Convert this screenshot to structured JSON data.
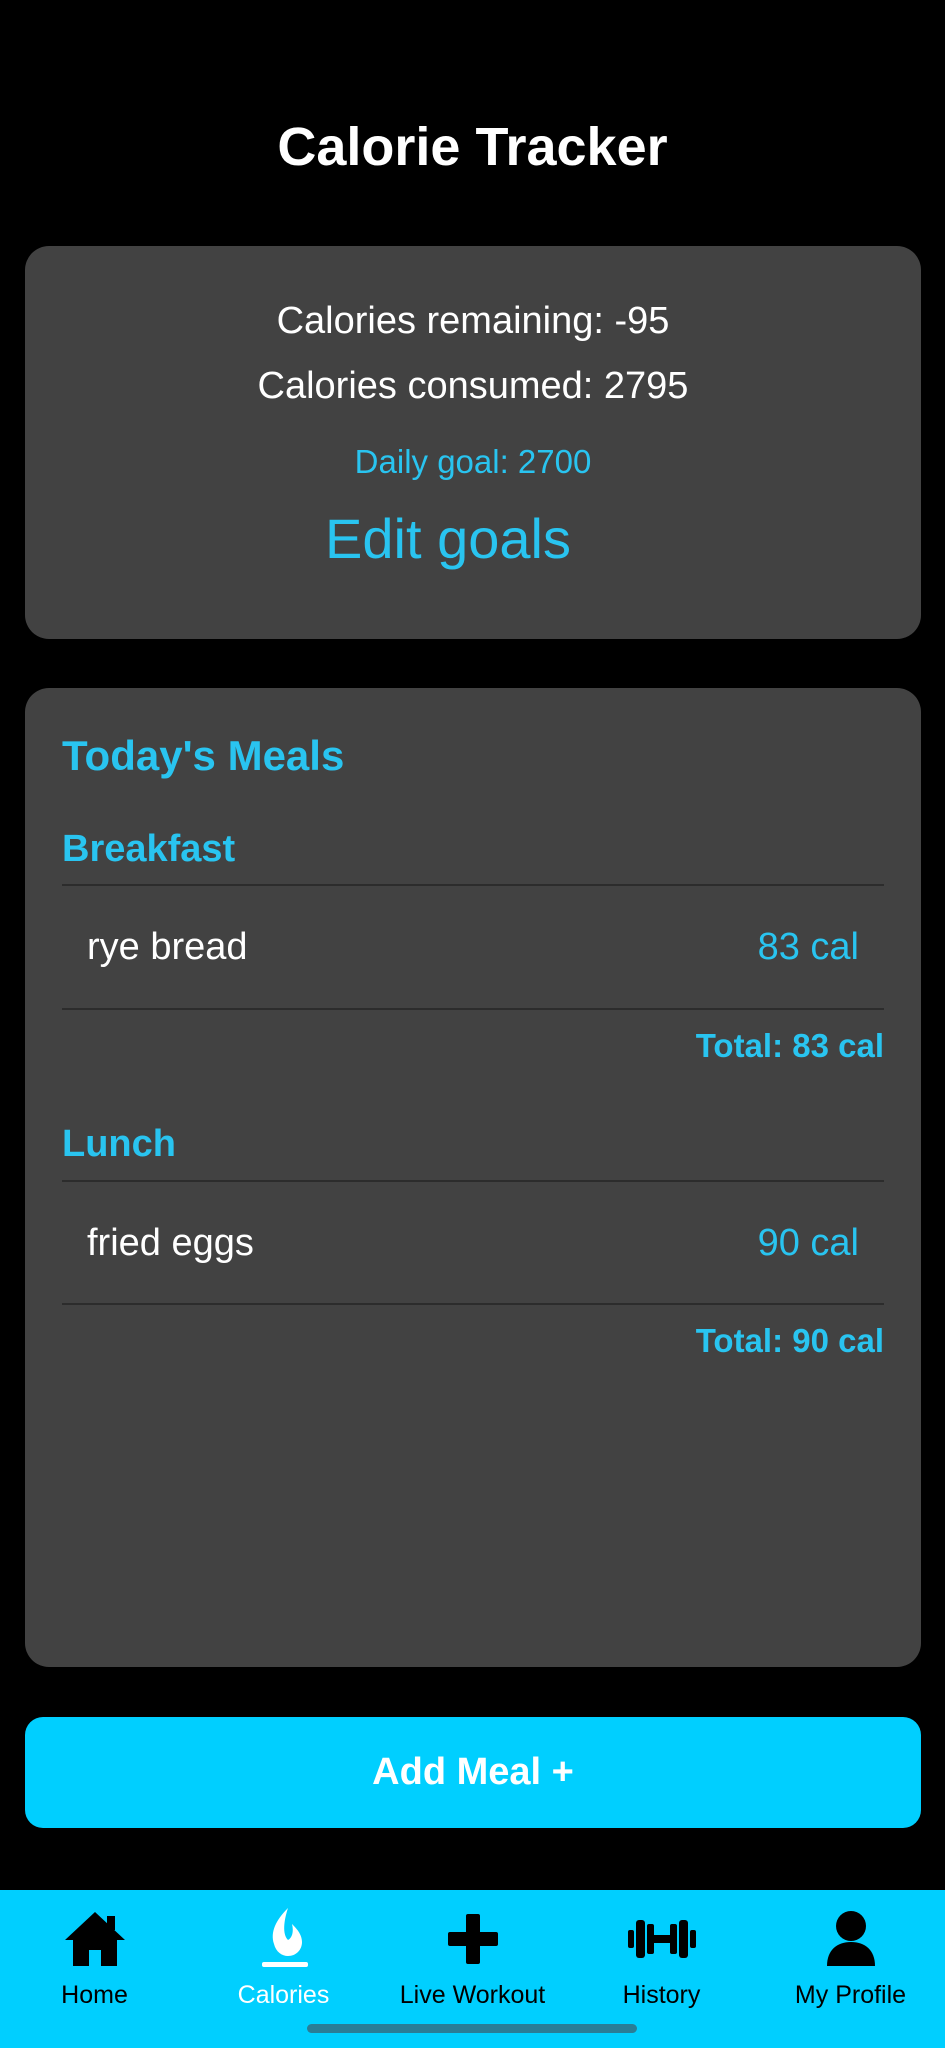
{
  "header": {
    "title": "Calorie Tracker"
  },
  "summary": {
    "remaining_text": "Calories remaining: -95",
    "consumed_text": "Calories consumed: 2795",
    "goal_text": "Daily goal: 2700",
    "edit_goals_label": "Edit goals"
  },
  "meals": {
    "title": "Today's Meals",
    "sections": [
      {
        "name": "Breakfast",
        "items": [
          {
            "name": "rye bread",
            "calories": "83 cal"
          }
        ],
        "total": "Total: 83 cal"
      },
      {
        "name": "Lunch",
        "items": [
          {
            "name": "fried eggs",
            "calories": "90 cal"
          }
        ],
        "total": "Total: 90 cal"
      }
    ]
  },
  "add_meal": {
    "label": "Add Meal +"
  },
  "nav": {
    "active": "Calories",
    "items": [
      {
        "label": "Home",
        "icon": "home-icon"
      },
      {
        "label": "Calories",
        "icon": "flame-icon"
      },
      {
        "label": "Live Workout",
        "icon": "plus-icon"
      },
      {
        "label": "History",
        "icon": "dumbbell-icon"
      },
      {
        "label": "My Profile",
        "icon": "person-icon"
      }
    ]
  },
  "colors": {
    "background": "#000000",
    "card": "#424242",
    "accent": "#29c4f0",
    "button": "#00cfff",
    "nav_background": "#00cfff"
  }
}
